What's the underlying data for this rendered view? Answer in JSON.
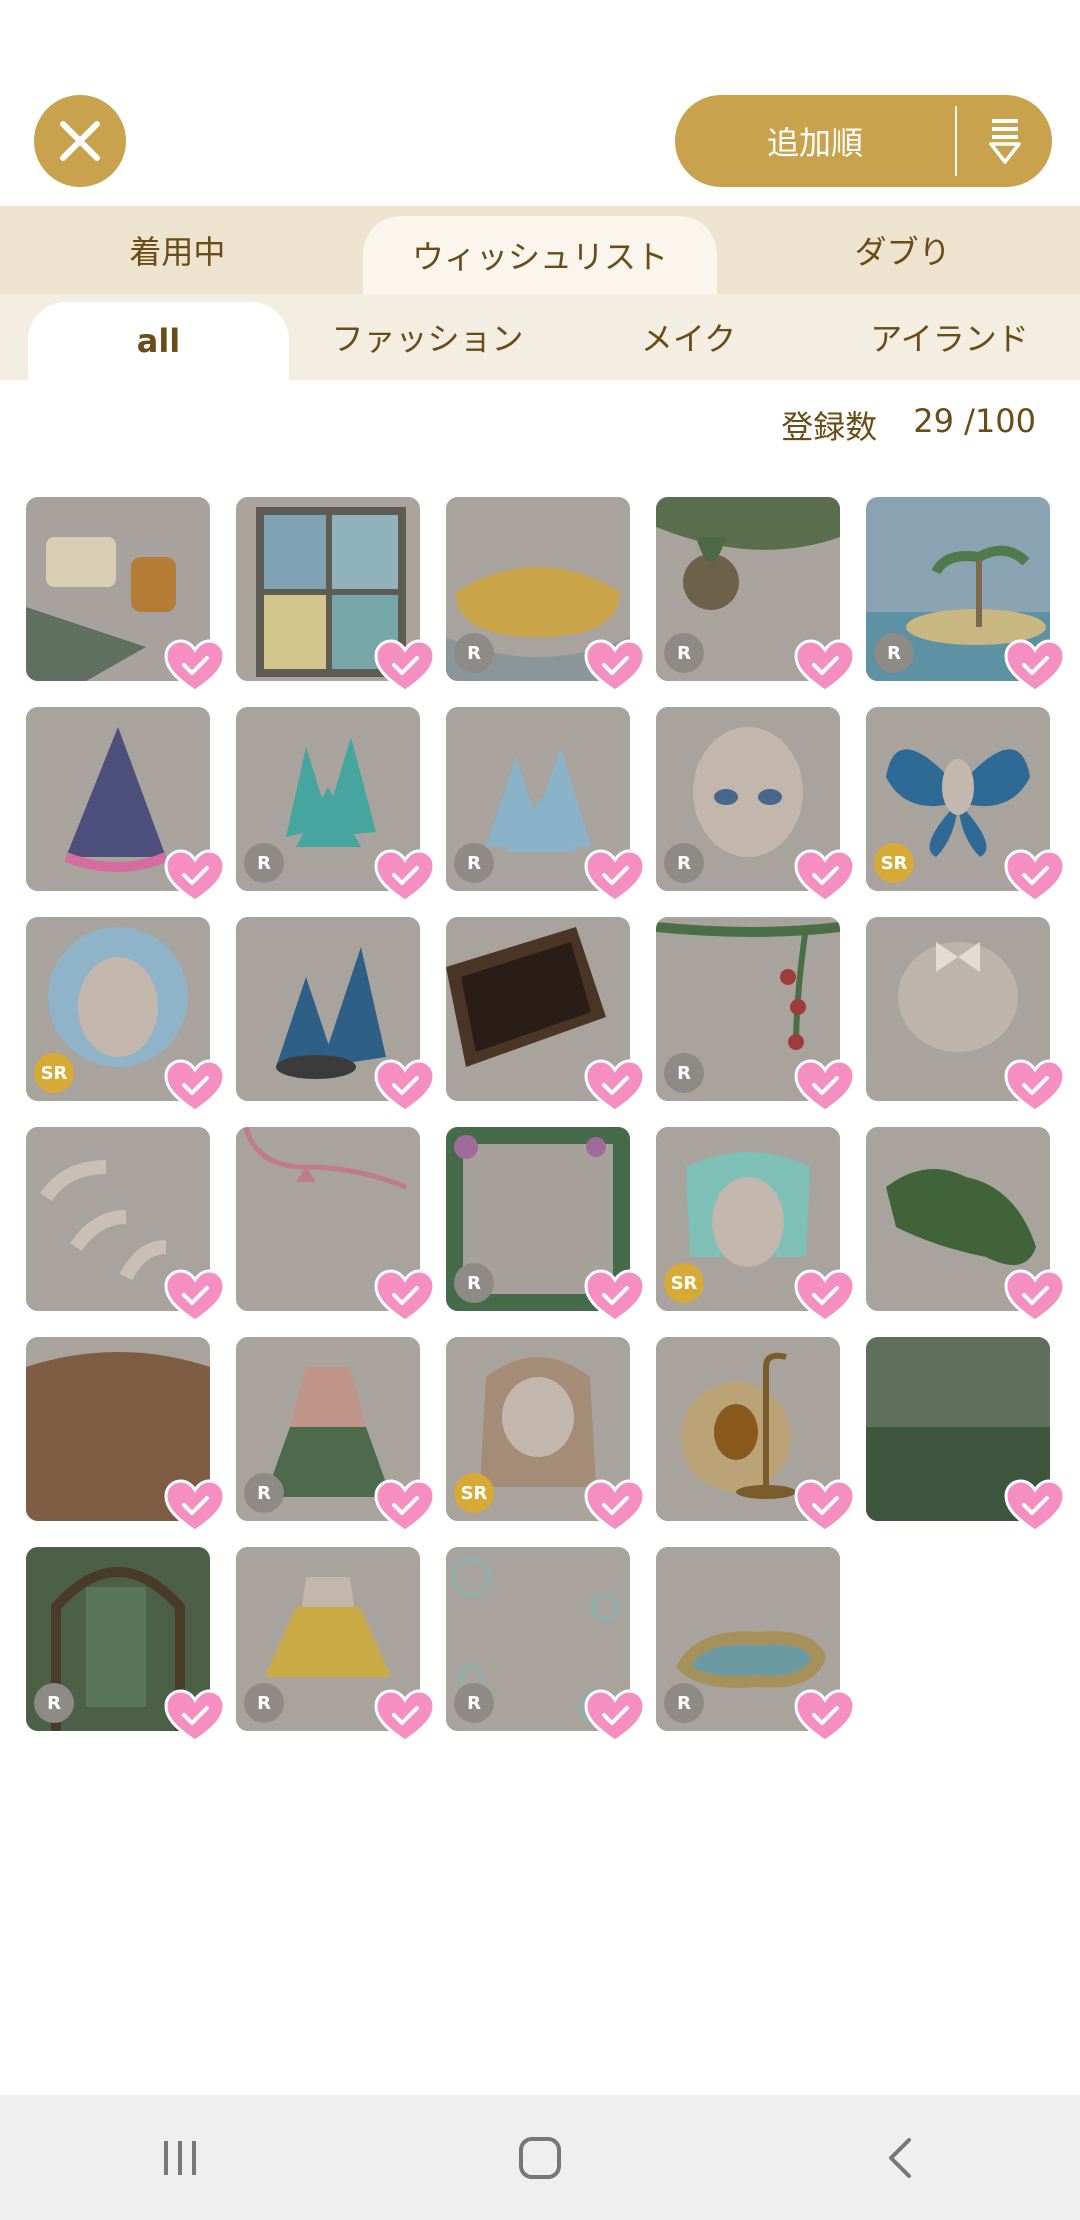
{
  "header": {
    "sort_label": "追加順"
  },
  "tabs": [
    {
      "label": "着用中",
      "active": false
    },
    {
      "label": "ウィッシュリスト",
      "active": true
    },
    {
      "label": "ダブり",
      "active": false
    }
  ],
  "subtabs": [
    {
      "label": "all",
      "active": true
    },
    {
      "label": "ファッション",
      "active": false
    },
    {
      "label": "メイク",
      "active": false
    },
    {
      "label": "アイランド",
      "active": false
    }
  ],
  "count": {
    "label": "登録数",
    "value": "29 /100"
  },
  "items": [
    {
      "rarity": "",
      "art": "beach-towel-bottles"
    },
    {
      "rarity": "",
      "art": "window-beach"
    },
    {
      "rarity": "R",
      "art": "sand-mat"
    },
    {
      "rarity": "R",
      "art": "hanging-fern"
    },
    {
      "rarity": "R",
      "art": "tropical-island"
    },
    {
      "rarity": "",
      "art": "purple-dress"
    },
    {
      "rarity": "R",
      "art": "teal-crystal"
    },
    {
      "rarity": "R",
      "art": "blue-crystal"
    },
    {
      "rarity": "R",
      "art": "face-eyes"
    },
    {
      "rarity": "SR",
      "art": "butterfly-wings"
    },
    {
      "rarity": "SR",
      "art": "blue-hair"
    },
    {
      "rarity": "",
      "art": "dark-crystal"
    },
    {
      "rarity": "",
      "art": "wooden-box"
    },
    {
      "rarity": "R",
      "art": "berry-vine"
    },
    {
      "rarity": "",
      "art": "white-ribbon-hair"
    },
    {
      "rarity": "",
      "art": "white-strands"
    },
    {
      "rarity": "",
      "art": "pink-ribbon"
    },
    {
      "rarity": "R",
      "art": "flower-frame"
    },
    {
      "rarity": "SR",
      "art": "aqua-hair"
    },
    {
      "rarity": "",
      "art": "clover-patch"
    },
    {
      "rarity": "",
      "art": "brown-round"
    },
    {
      "rarity": "R",
      "art": "green-dress"
    },
    {
      "rarity": "SR",
      "art": "long-hair"
    },
    {
      "rarity": "",
      "art": "acorn-lamp"
    },
    {
      "rarity": "",
      "art": "forest-bg"
    },
    {
      "rarity": "R",
      "art": "forest-arch"
    },
    {
      "rarity": "R",
      "art": "yellow-skirt"
    },
    {
      "rarity": "R",
      "art": "bubbles"
    },
    {
      "rarity": "R",
      "art": "opal-pond"
    }
  ],
  "colors": {
    "accent_gold": "#c9a24d",
    "heart_pink": "#f58fc2",
    "text_brown": "#6b4b16"
  }
}
